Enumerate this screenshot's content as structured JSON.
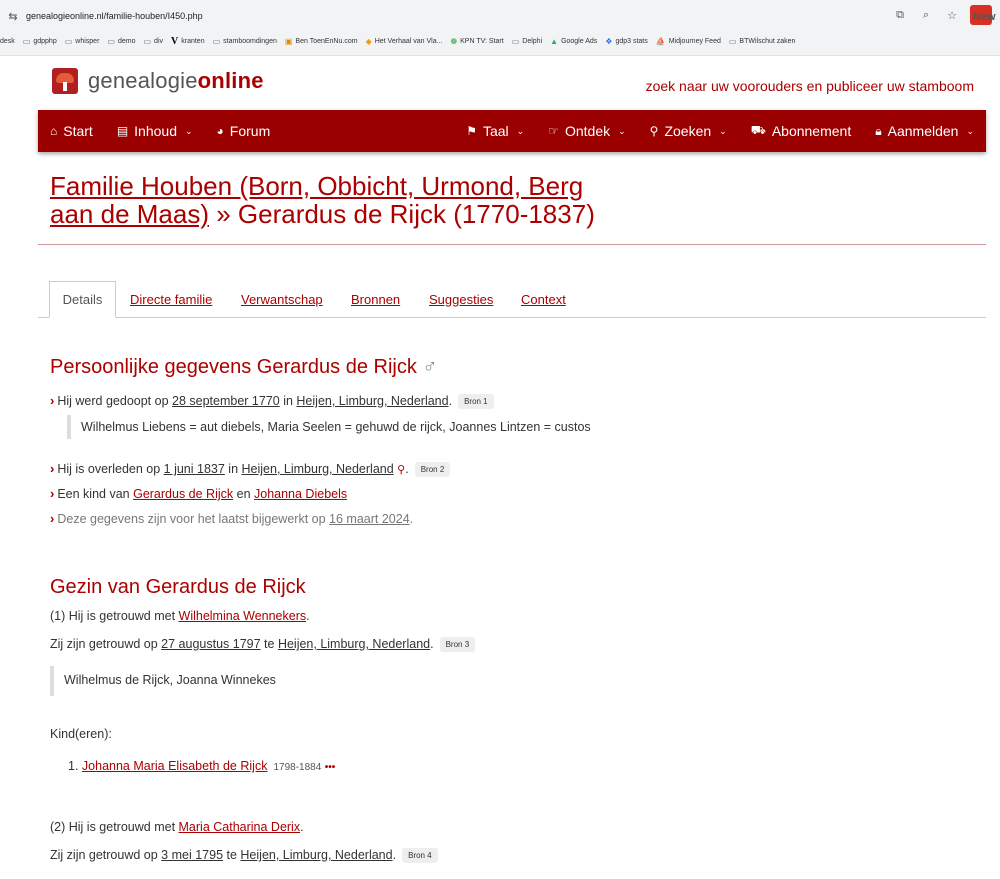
{
  "browser": {
    "url": "genealogieonline.nl/familie-houben/I450.php",
    "ext_label": "New",
    "bookmarks": [
      "desk",
      "gdpphp",
      "whisper",
      "demo",
      "div",
      "kranten",
      "stamboomdingen",
      "Ben ToenEnNu.com",
      "Het Verhaal van Vla...",
      "KPN TV: Start",
      "Delphi",
      "Google Ads",
      "gdp3 stats",
      "Midjourney Feed",
      "BTWilschut zaken"
    ]
  },
  "site": {
    "logo_plain": "genealogie",
    "logo_bold": "online",
    "tagline": "zoek naar uw voorouders en publiceer uw stamboom"
  },
  "nav": {
    "start": "Start",
    "inhoud": "Inhoud",
    "forum": "Forum",
    "taal": "Taal",
    "ontdek": "Ontdek",
    "zoeken": "Zoeken",
    "abonnement": "Abonnement",
    "aanmelden": "Aanmelden"
  },
  "title": {
    "tree_link": "Familie Houben (Born, Obbicht, Urmond, Berg aan de Maas)",
    "person": " » Gerardus de Rijck (1770-1837)"
  },
  "tabs": {
    "details": "Details",
    "directe_familie": "Directe familie",
    "verwantschap": "Verwantschap",
    "bronnen": "Bronnen",
    "suggesties": "Suggesties",
    "context": "Context"
  },
  "personal": {
    "heading": "Persoonlijke gegevens Gerardus de Rijck",
    "sex_symbol": "♂",
    "baptized": {
      "pre": "Hij werd gedoopt op ",
      "date": "28 september 1770",
      "mid": " in ",
      "place": "Heijen, Limburg, Nederland",
      "post": ".",
      "source": "Bron 1"
    },
    "baptism_note": "Wilhelmus Liebens = aut diebels, Maria Seelen = gehuwd de rijck, Joannes Lintzen = custos",
    "died": {
      "pre": "Hij is overleden op ",
      "date": "1 juni 1837",
      "mid": " in ",
      "place": "Heijen, Limburg, Nederland",
      "post": ".",
      "source": "Bron 2"
    },
    "child_of": {
      "pre": "Een kind van ",
      "father": "Gerardus de Rijck",
      "mid": " en ",
      "mother": "Johanna Diebels"
    },
    "updated": {
      "pre": "Deze gegevens zijn voor het laatst bijgewerkt op ",
      "date": "16 maart 2024",
      "post": "."
    }
  },
  "family": {
    "heading": "Gezin van Gerardus de Rijck",
    "marriage1": {
      "pre": "(1) Hij is getrouwd met ",
      "spouse": "Wilhelmina Wennekers",
      "post": ".",
      "date_pre": "Zij zijn getrouwd op ",
      "date": "27 augustus 1797",
      "date_mid": " te ",
      "place": "Heijen, Limburg, Nederland",
      "date_post": ".",
      "source": "Bron 3",
      "note": "Wilhelmus de Rijck, Joanna Winnekes"
    },
    "children_label": "Kind(eren):",
    "child1": {
      "num": "1.",
      "name": "Johanna Maria Elisabeth de Rijck",
      "dates": "1798-1884",
      "more": "•••"
    },
    "marriage2": {
      "pre": "(2) Hij is getrouwd met ",
      "spouse": "Maria Catharina Derix",
      "post": ".",
      "date_pre": "Zij zijn getrouwd op ",
      "date": "3 mei 1795",
      "date_mid": " te ",
      "place": "Heijen, Limburg, Nederland",
      "date_post": ".",
      "source": "Bron 4"
    }
  }
}
